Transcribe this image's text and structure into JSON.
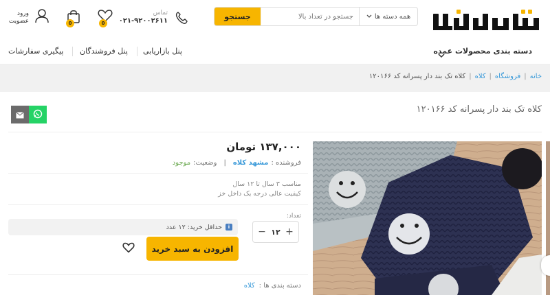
{
  "header": {
    "logo_text": "تعدادبالا",
    "search": {
      "button_label": "جستجو",
      "placeholder": "جستجو در تعداد بالا",
      "category_label": "همه دسته ها"
    },
    "contact": {
      "label": "تماس",
      "phone": "۰۲۱-۹۲۰۰۲۶۱۱"
    },
    "wishlist_count": "0",
    "cart_count": "0",
    "login_line1": "ورود",
    "login_line2": "عضویت"
  },
  "nav": {
    "categories": "دسته بندی محصولات عمده",
    "marketing_panel": "پنل بازاریابی",
    "sellers_panel": "پنل فروشندگان",
    "order_tracking": "پیگیری سفارشات"
  },
  "breadcrumb": {
    "home": "خانه",
    "shop": "فروشگاه",
    "category": "کلاه",
    "current": "کلاه تک بند دار پسرانه کد ۱۲۰۱۶۶"
  },
  "product": {
    "title": "کلاه تک بند دار پسرانه کد ۱۲۰۱۶۶",
    "price": "۱۳۷,۰۰۰ تومان",
    "seller_label": "فروشنده :",
    "seller_name": "مشهد کلاه",
    "stock_label": "وضعیت:",
    "stock_value": "موجود",
    "description_line1": "مناسب ۳ سال تا ۱۲ سال",
    "description_line2": "کیفیت عالی درجه یک داخل خز",
    "quantity_label": "تعداد:",
    "quantity_value": "۱۲",
    "min_purchase": "حداقل خرید: ۱۲ عدد",
    "add_to_cart": "افزودن به سبد خرید",
    "categories_label": "دسته بندی ها :",
    "category_link": "کلاه"
  },
  "colors": {
    "accent": "#f7b500",
    "link": "#3a9ad9",
    "whatsapp": "#25d366",
    "email": "#6b6b6b"
  },
  "icons": [
    "search-icon",
    "phone-icon",
    "heart-icon",
    "bag-icon",
    "user-icon",
    "chevron-down-icon",
    "whatsapp-icon",
    "email-icon",
    "info-icon"
  ]
}
